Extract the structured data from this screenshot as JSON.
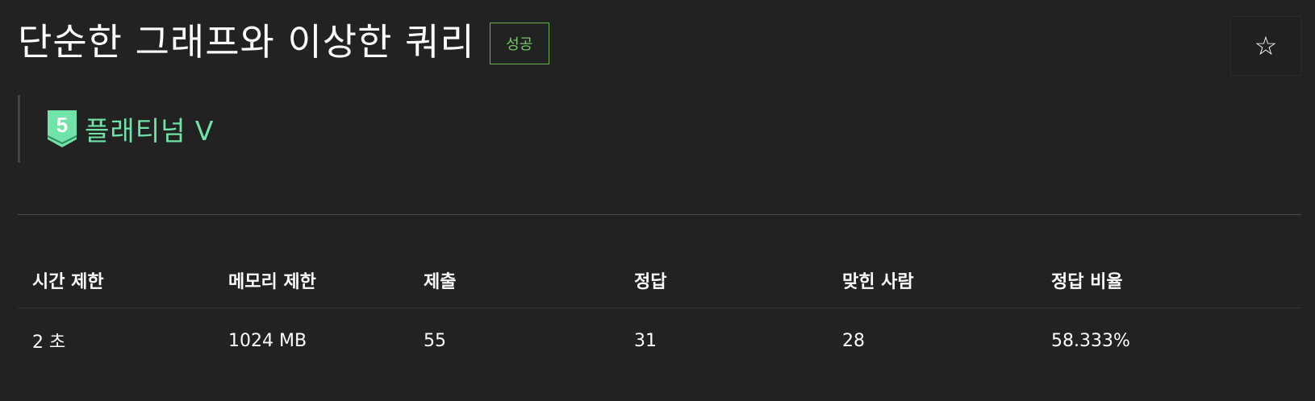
{
  "header": {
    "title": "단순한 그래프와 이상한 쿼리",
    "result_badge": "성공",
    "star_icon": "☆"
  },
  "tier": {
    "level": "5",
    "label": "플래티넘 V",
    "color": "#6fe3a8"
  },
  "info_table": {
    "columns": [
      "시간 제한",
      "메모리 제한",
      "제출",
      "정답",
      "맞힌 사람",
      "정답 비율"
    ],
    "values": [
      "2 초",
      "1024 MB",
      "55",
      "31",
      "28",
      "58.333%"
    ]
  }
}
